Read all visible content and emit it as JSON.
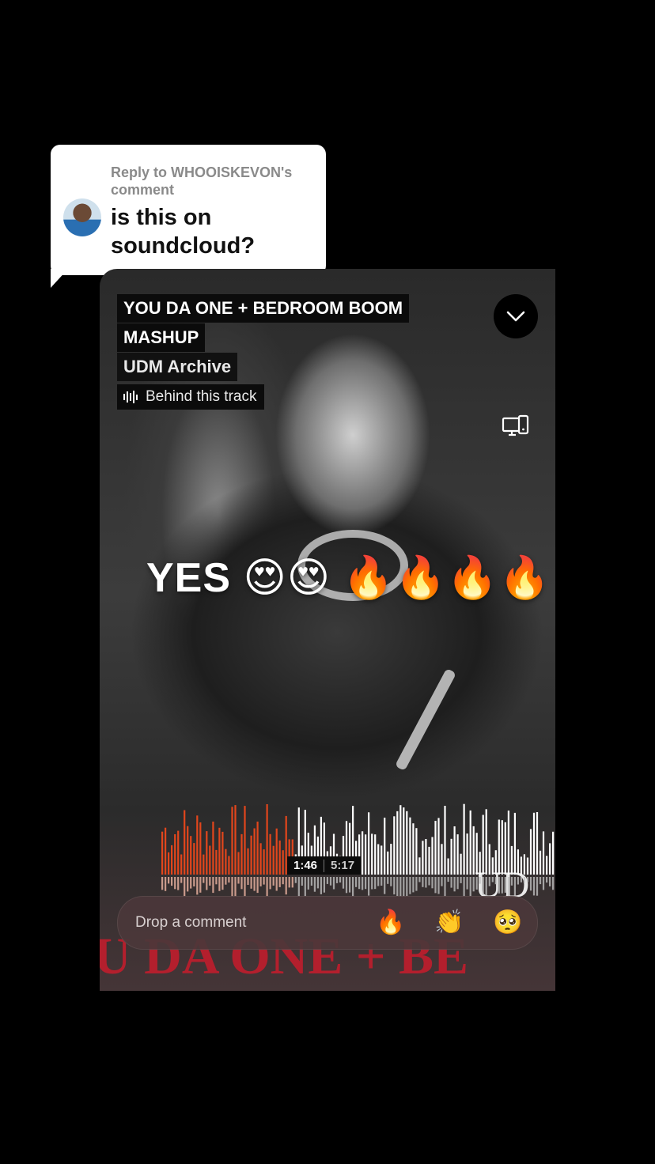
{
  "reply": {
    "meta": "Reply to WHOOISKEVON's comment",
    "text": "is this on soundcloud?"
  },
  "track": {
    "title_line1": "YOU DA ONE + BEDROOM BOOM",
    "title_line2": "MASHUP",
    "artist": "UDM Archive",
    "behind_label": "Behind this track"
  },
  "overlay_caption": "YES 😍😍 🔥🔥🔥🔥",
  "player": {
    "current_time": "1:46",
    "total_time": "5:17",
    "progress_fraction": 0.335,
    "played_color": "#e2461c",
    "unplayed_color": "#ffffff"
  },
  "background_text": {
    "title": "U DA ONE + BE",
    "logo": "UD"
  },
  "comment_bar": {
    "placeholder": "Drop a comment",
    "reactions": [
      "🔥",
      "👏",
      "🥺"
    ]
  },
  "icons": {
    "collapse": "chevron-down-icon",
    "cast": "cast-devices-icon",
    "behind": "waveform-icon"
  }
}
